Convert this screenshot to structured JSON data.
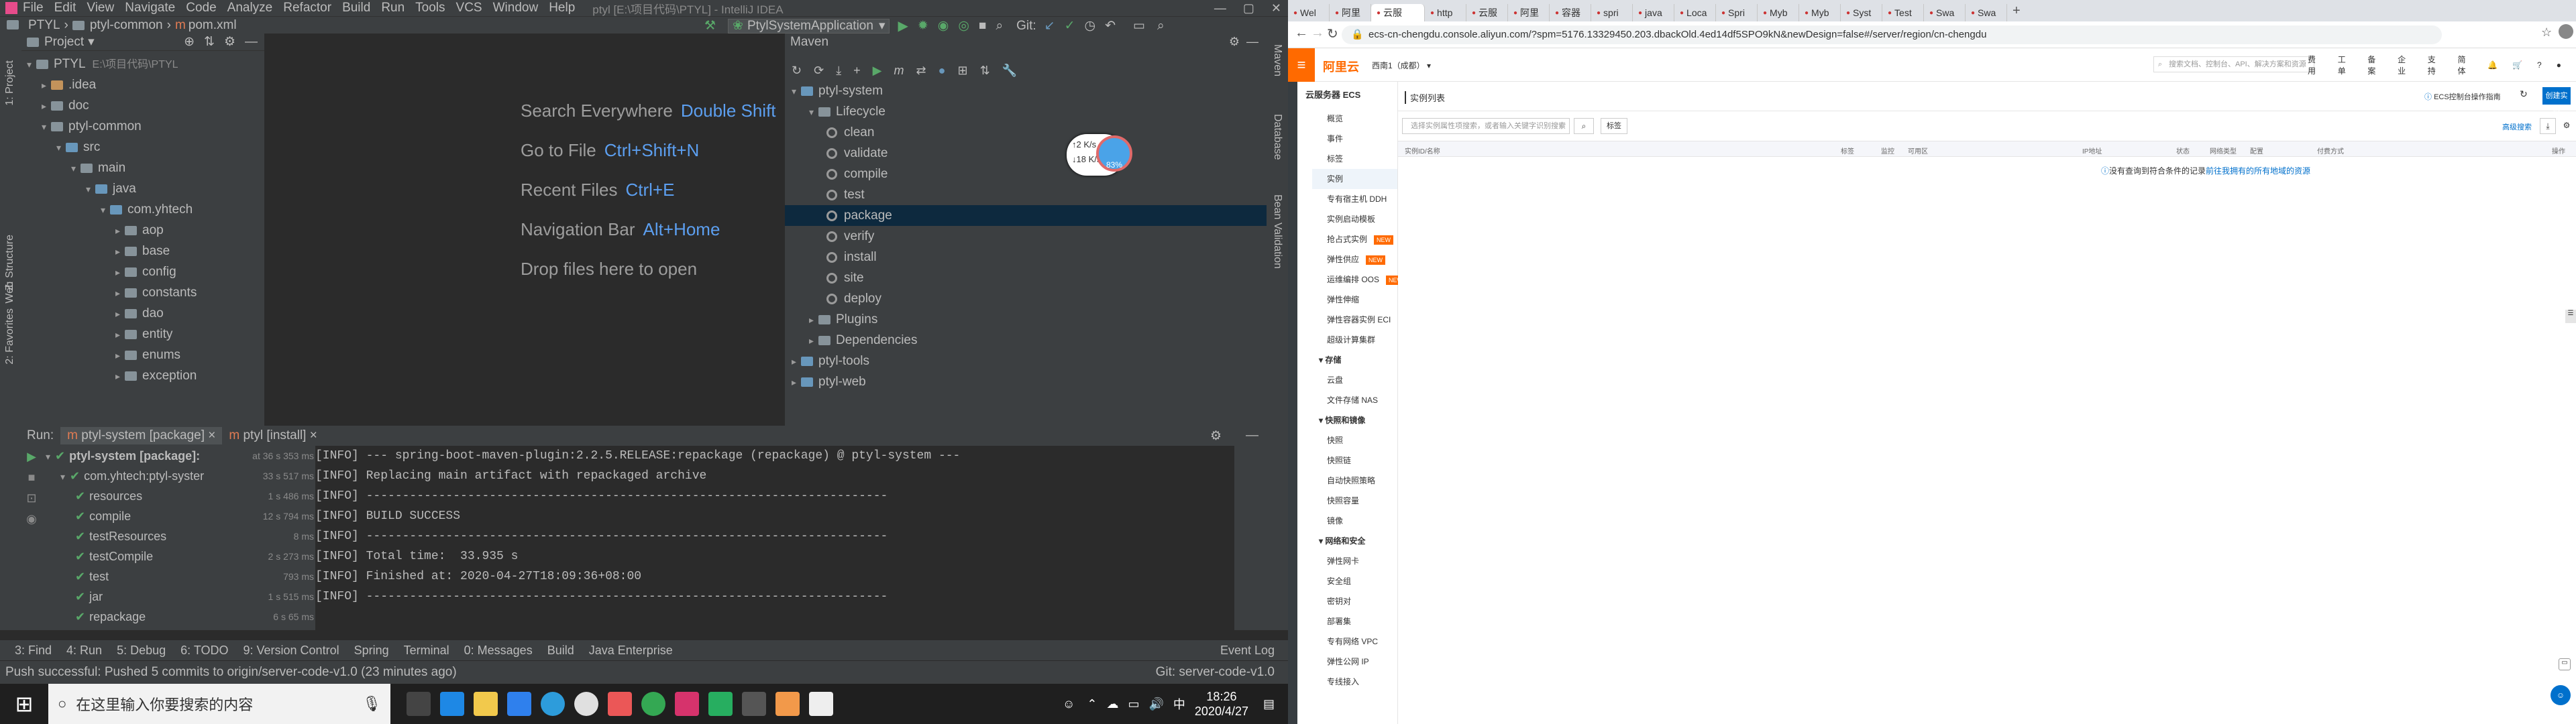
{
  "ide": {
    "title": "ptyl [E:\\项目代码\\PTYL] - IntelliJ IDEA",
    "menu": [
      "File",
      "Edit",
      "View",
      "Navigate",
      "Code",
      "Analyze",
      "Refactor",
      "Build",
      "Run",
      "Tools",
      "VCS",
      "Window",
      "Help"
    ],
    "breadcrumb": [
      "PTYL",
      "ptyl-common",
      "pom.xml"
    ],
    "run_config": "PtylSystemApplication",
    "git_label": "Git:",
    "project_panel_title": "Project",
    "project_tree": [
      {
        "label": "PTYL",
        "extra": "E:\\项目代码\\PTYL",
        "depth": 0,
        "open": true
      },
      {
        "label": ".idea",
        "depth": 1,
        "open": false
      },
      {
        "label": "doc",
        "depth": 1,
        "open": false
      },
      {
        "label": "ptyl-common",
        "depth": 1,
        "open": true
      },
      {
        "label": "src",
        "depth": 2,
        "open": true
      },
      {
        "label": "main",
        "depth": 3,
        "open": true
      },
      {
        "label": "java",
        "depth": 4,
        "open": true
      },
      {
        "label": "com.yhtech",
        "depth": 5,
        "open": true
      },
      {
        "label": "aop",
        "depth": 6,
        "open": false
      },
      {
        "label": "base",
        "depth": 6,
        "open": false
      },
      {
        "label": "config",
        "depth": 6,
        "open": false
      },
      {
        "label": "constants",
        "depth": 6,
        "open": false
      },
      {
        "label": "dao",
        "depth": 6,
        "open": false
      },
      {
        "label": "entity",
        "depth": 6,
        "open": false
      },
      {
        "label": "enums",
        "depth": 6,
        "open": false
      },
      {
        "label": "exception",
        "depth": 6,
        "open": false
      }
    ],
    "editor_hints": [
      {
        "label": "Search Everywhere",
        "key": "Double Shift"
      },
      {
        "label": "Go to File",
        "key": "Ctrl+Shift+N"
      },
      {
        "label": "Recent Files",
        "key": "Ctrl+E"
      },
      {
        "label": "Navigation Bar",
        "key": "Alt+Home"
      },
      {
        "label": "Drop files here to open",
        "key": ""
      }
    ],
    "maven": {
      "title": "Maven",
      "tree": [
        {
          "label": "ptyl-system",
          "depth": 0,
          "kind": "module"
        },
        {
          "label": "Lifecycle",
          "depth": 1,
          "kind": "folder"
        },
        {
          "label": "clean",
          "depth": 2,
          "kind": "goal"
        },
        {
          "label": "validate",
          "depth": 2,
          "kind": "goal"
        },
        {
          "label": "compile",
          "depth": 2,
          "kind": "goal"
        },
        {
          "label": "test",
          "depth": 2,
          "kind": "goal"
        },
        {
          "label": "package",
          "depth": 2,
          "kind": "goal",
          "selected": true
        },
        {
          "label": "verify",
          "depth": 2,
          "kind": "goal"
        },
        {
          "label": "install",
          "depth": 2,
          "kind": "goal"
        },
        {
          "label": "site",
          "depth": 2,
          "kind": "goal"
        },
        {
          "label": "deploy",
          "depth": 2,
          "kind": "goal"
        },
        {
          "label": "Plugins",
          "depth": 1,
          "kind": "folder"
        },
        {
          "label": "Dependencies",
          "depth": 1,
          "kind": "folder"
        },
        {
          "label": "ptyl-tools",
          "depth": 0,
          "kind": "module"
        },
        {
          "label": "ptyl-web",
          "depth": 0,
          "kind": "module"
        }
      ]
    },
    "netspeed": {
      "up": "2 K/s",
      "down": "18 K/s",
      "percent": "83%"
    },
    "run": {
      "label": "Run:",
      "tabs": [
        "ptyl-system [package]",
        "ptyl [install]"
      ],
      "tree": [
        {
          "label": "ptyl-system [package]:",
          "time": "at 36 s 353 ms",
          "depth": 0
        },
        {
          "label": "com.yhtech:ptyl-syster",
          "time": "33 s 517 ms",
          "depth": 1
        },
        {
          "label": "resources",
          "time": "1 s 486 ms",
          "depth": 2
        },
        {
          "label": "compile",
          "time": "12 s 794 ms",
          "depth": 2
        },
        {
          "label": "testResources",
          "time": "8 ms",
          "depth": 2
        },
        {
          "label": "testCompile",
          "time": "2 s 273 ms",
          "depth": 2
        },
        {
          "label": "test",
          "time": "793 ms",
          "depth": 2
        },
        {
          "label": "jar",
          "time": "1 s 515 ms",
          "depth": 2
        },
        {
          "label": "repackage",
          "time": "6 s 65 ms",
          "depth": 2
        }
      ],
      "console": [
        "[INFO] --- spring-boot-maven-plugin:2.2.5.RELEASE:repackage (repackage) @ ptyl-system ---",
        "[INFO] Replacing main artifact with repackaged archive",
        "[INFO] ------------------------------------------------------------------------",
        "[INFO] BUILD SUCCESS",
        "[INFO] ------------------------------------------------------------------------",
        "[INFO] Total time:  33.935 s",
        "[INFO] Finished at: 2020-04-27T18:09:36+08:00",
        "[INFO] ------------------------------------------------------------------------"
      ]
    },
    "bottom_tabs": [
      "3: Find",
      "4: Run",
      "5: Debug",
      "6: TODO",
      "9: Version Control",
      "Spring",
      "Terminal",
      "0: Messages",
      "Build",
      "Java Enterprise"
    ],
    "event_log": "Event Log",
    "status_message": "Push successful: Pushed 5 commits to origin/server-code-v1.0 (23 minutes ago)",
    "git_branch": "Git: server-code-v1.0",
    "left_strip": [
      "1: Project",
      "Z: Structure",
      "Web",
      "2: Favorites"
    ],
    "right_strip": [
      "Maven",
      "Database",
      "Bean Validation"
    ]
  },
  "taskbar": {
    "search_placeholder": "在这里输入你要搜索的内容",
    "time": "18:26",
    "date": "2020/4/27",
    "ime": "中"
  },
  "browser": {
    "tabs": [
      "Wel",
      "阿里",
      "云服",
      "http",
      "云服",
      "阿里",
      "容器",
      "spri",
      "java",
      "Loca",
      "Spri",
      "Myb",
      "Myb",
      "Syst",
      "Test",
      "Swa",
      "Swa"
    ],
    "url": "ecs-cn-chengdu.console.aliyun.com/?spm=5176.13329450.203.dbackOld.4ed14df5SPO9kN&newDesign=false#/server/region/cn-chengdu",
    "aliyun": {
      "logo": "阿里云",
      "region": "西南1（成都）",
      "search_placeholder": "搜索文档、控制台、API、解决方案和资源",
      "nav": [
        "费用",
        "工单",
        "备案",
        "企业",
        "支持",
        "简体"
      ],
      "product": "云服务器 ECS",
      "page_title": "实例列表",
      "helper_link": "ECS控制台操作指南",
      "create_button": "创建实例",
      "filter_placeholder": "选择实例属性项搜索，或者输入关键字识别搜索",
      "tag_button": "标签",
      "advanced_search": "高级搜索",
      "columns": [
        "实例ID/名称",
        "标签",
        "监控",
        "可用区",
        "IP地址",
        "状态",
        "网络类型",
        "配置",
        "付费方式",
        "操作"
      ],
      "empty_prefix": "没有查询到符合条件的记录",
      "empty_link": "前往我拥有的所有地域的资源",
      "sidebar": [
        {
          "label": "概览",
          "group": false
        },
        {
          "label": "事件",
          "group": false
        },
        {
          "label": "标签",
          "group": false
        },
        {
          "label": "实例",
          "group": false,
          "active": true
        },
        {
          "label": "专有宿主机 DDH",
          "group": false
        },
        {
          "label": "实例启动模板",
          "group": false
        },
        {
          "label": "抢占式实例",
          "group": false,
          "badge": "NEW"
        },
        {
          "label": "弹性供应",
          "group": false,
          "badge": "NEW"
        },
        {
          "label": "运维编排 OOS",
          "group": false,
          "badge": "NEW"
        },
        {
          "label": "弹性伸缩",
          "group": false
        },
        {
          "label": "弹性容器实例 ECI",
          "group": false
        },
        {
          "label": "超级计算集群",
          "group": false
        },
        {
          "label": "存储",
          "group": true
        },
        {
          "label": "云盘",
          "group": false
        },
        {
          "label": "文件存储 NAS",
          "group": false
        },
        {
          "label": "快照和镜像",
          "group": true
        },
        {
          "label": "快照",
          "group": false
        },
        {
          "label": "快照链",
          "group": false
        },
        {
          "label": "自动快照策略",
          "group": false
        },
        {
          "label": "快照容量",
          "group": false
        },
        {
          "label": "镜像",
          "group": false
        },
        {
          "label": "网络和安全",
          "group": true
        },
        {
          "label": "弹性网卡",
          "group": false
        },
        {
          "label": "安全组",
          "group": false
        },
        {
          "label": "密钥对",
          "group": false
        },
        {
          "label": "部署集",
          "group": false
        },
        {
          "label": "专有网络 VPC",
          "group": false
        },
        {
          "label": "弹性公网 IP",
          "group": false
        },
        {
          "label": "专线接入",
          "group": false
        }
      ]
    }
  }
}
